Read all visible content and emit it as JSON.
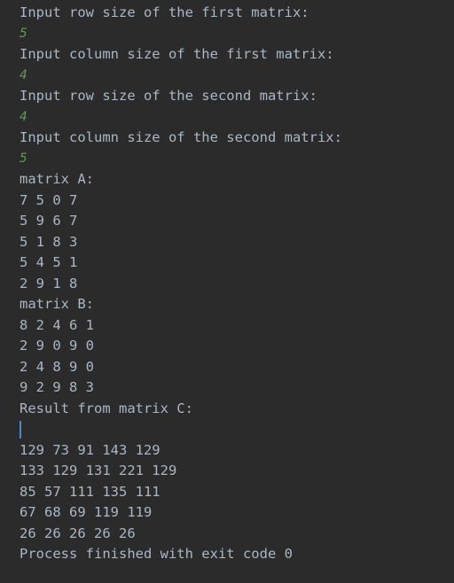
{
  "console": {
    "lines": [
      {
        "text": "Input row size of the first matrix:",
        "kind": "output"
      },
      {
        "text": "5",
        "kind": "input"
      },
      {
        "text": "Input column size of the first matrix:",
        "kind": "output"
      },
      {
        "text": "4",
        "kind": "input"
      },
      {
        "text": "Input row size of the second matrix:",
        "kind": "output"
      },
      {
        "text": "4",
        "kind": "input"
      },
      {
        "text": "Input column size of the second matrix:",
        "kind": "output"
      },
      {
        "text": "5",
        "kind": "input"
      },
      {
        "text": "matrix A:",
        "kind": "output"
      },
      {
        "text": "7 5 0 7",
        "kind": "output"
      },
      {
        "text": "5 9 6 7",
        "kind": "output"
      },
      {
        "text": "5 1 8 3",
        "kind": "output"
      },
      {
        "text": "5 4 5 1",
        "kind": "output"
      },
      {
        "text": "2 9 1 8",
        "kind": "output"
      },
      {
        "text": "matrix B:",
        "kind": "output"
      },
      {
        "text": "8 2 4 6 1",
        "kind": "output"
      },
      {
        "text": "2 9 0 9 0",
        "kind": "output"
      },
      {
        "text": "2 4 8 9 0",
        "kind": "output"
      },
      {
        "text": "9 2 9 8 3",
        "kind": "output"
      },
      {
        "text": "Result from matrix C:",
        "kind": "output"
      },
      {
        "text": "",
        "kind": "caret"
      },
      {
        "text": "129 73 91 143 129",
        "kind": "output"
      },
      {
        "text": "133 129 131 221 129",
        "kind": "output"
      },
      {
        "text": "85 57 111 135 111",
        "kind": "output"
      },
      {
        "text": "67 68 69 119 119",
        "kind": "output"
      },
      {
        "text": "26 26 26 26 26",
        "kind": "output"
      },
      {
        "text": "Process finished with exit code 0",
        "kind": "output"
      }
    ]
  },
  "colors": {
    "background": "#2b2b2b",
    "output_text": "#a9b7c6",
    "user_input": "#629755",
    "caret": "#4a88c7"
  }
}
